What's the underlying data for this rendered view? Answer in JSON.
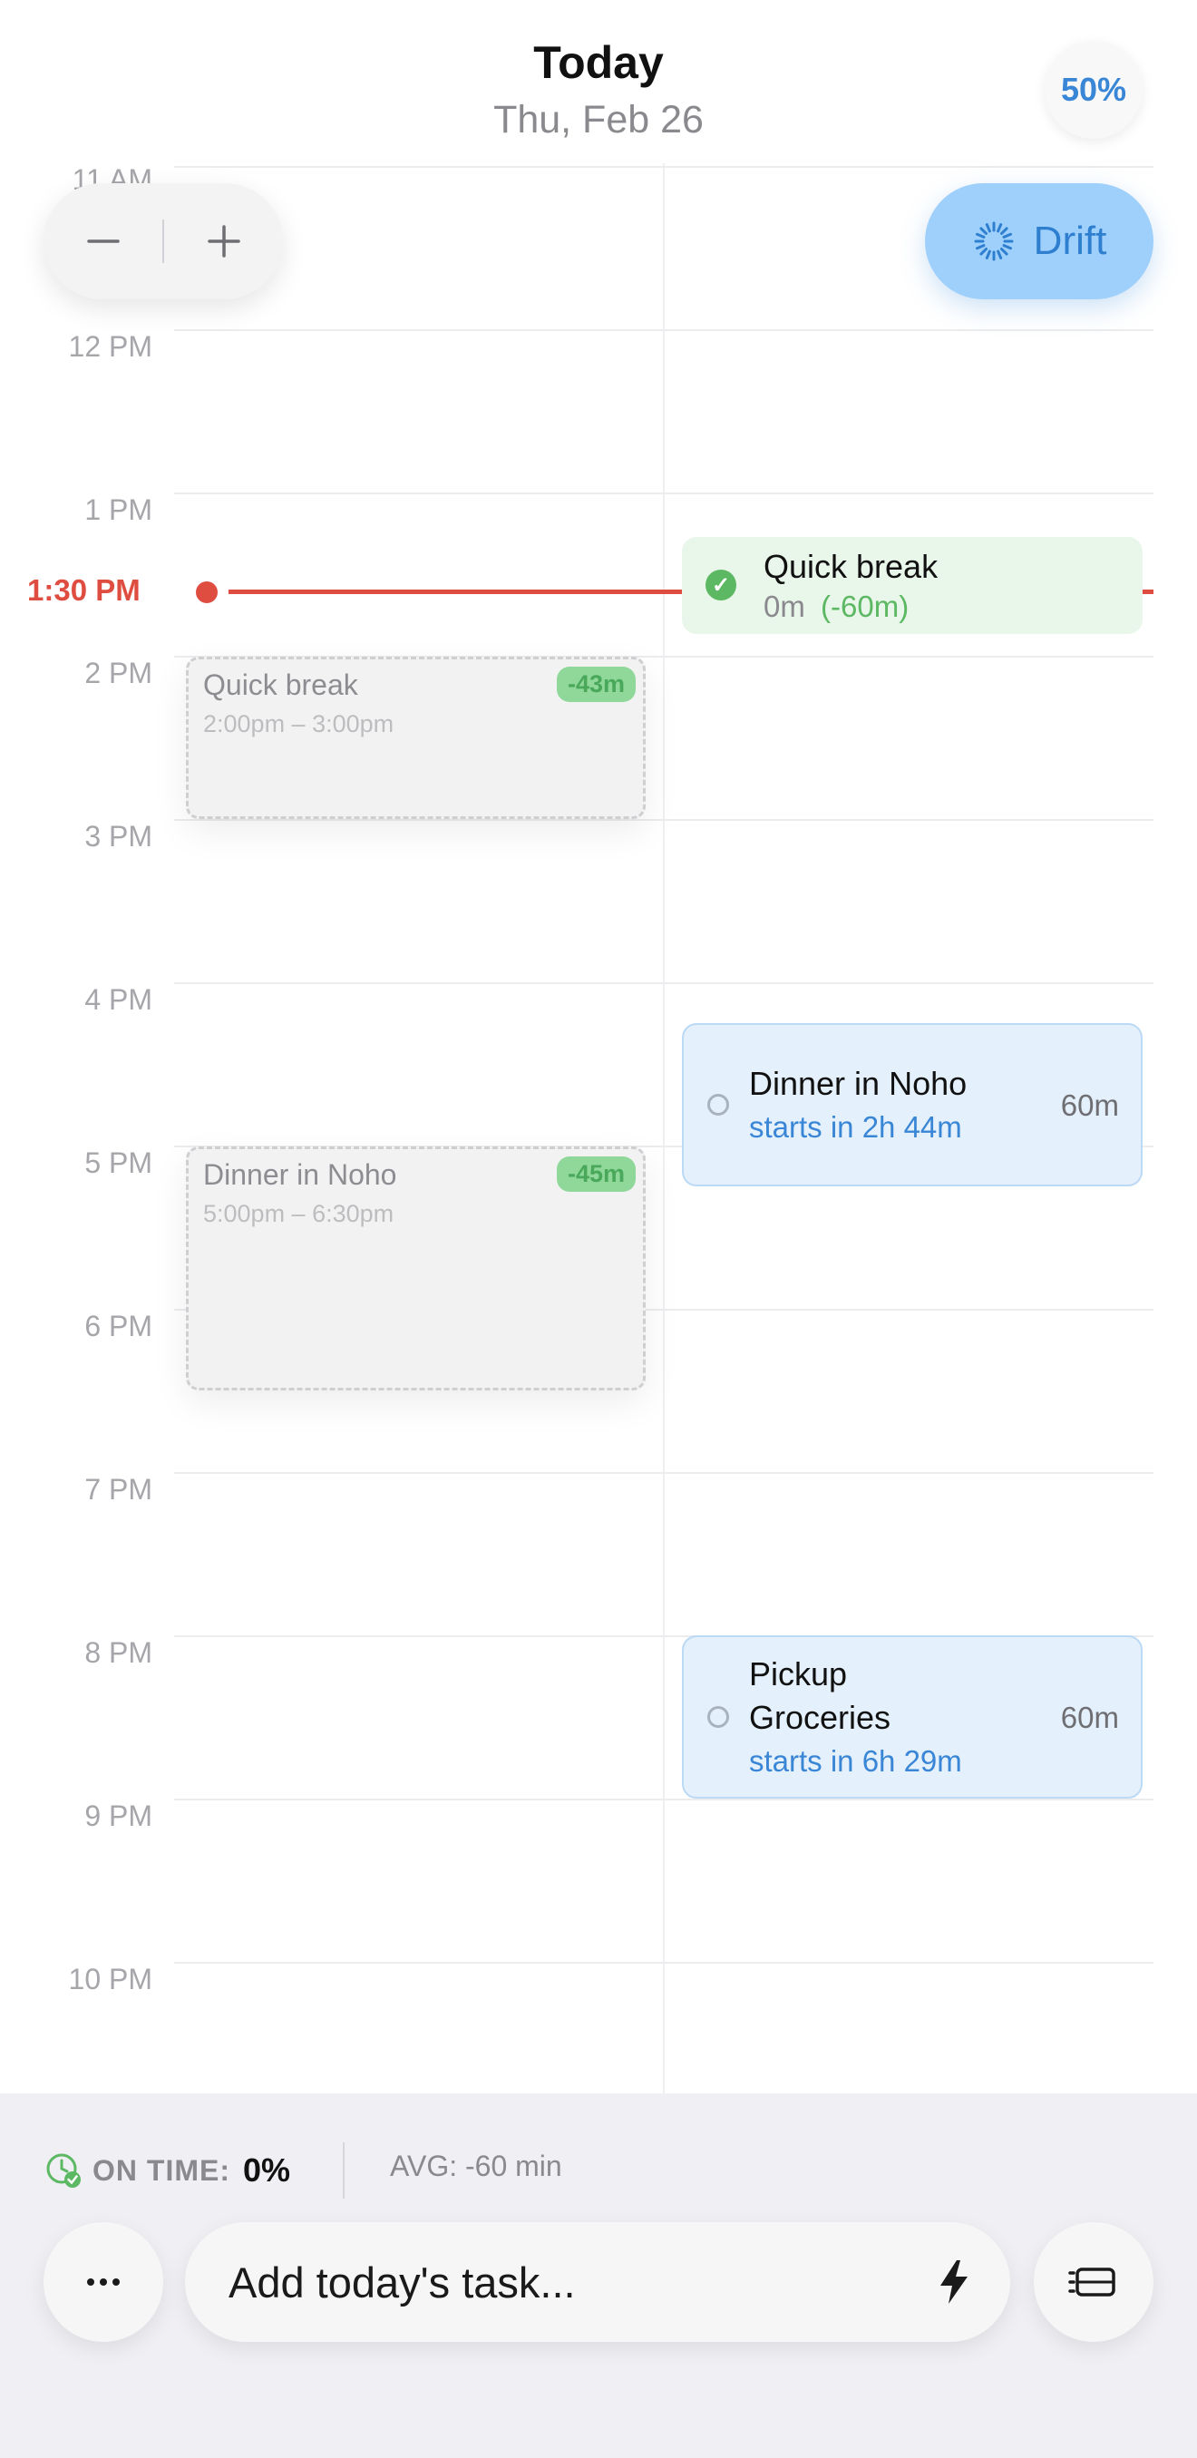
{
  "header": {
    "title": "Today",
    "date": "Thu, Feb 26",
    "percent": "50%"
  },
  "zoom": {
    "minus_icon": "minus-icon",
    "plus_icon": "plus-icon"
  },
  "drift": {
    "label": "Drift",
    "icon": "spinner-icon"
  },
  "timeline": {
    "hours": [
      "11 AM",
      "12 PM",
      "1 PM",
      "2 PM",
      "3 PM",
      "4 PM",
      "5 PM",
      "6 PM",
      "7 PM",
      "8 PM",
      "9 PM",
      "10 PM"
    ],
    "now_label": "1:30 PM"
  },
  "planned": [
    {
      "title": "Quick break",
      "time": "2:00pm – 3:00pm",
      "badge": "-43m"
    },
    {
      "title": "Dinner in Noho",
      "time": "5:00pm – 6:30pm",
      "badge": "-45m"
    }
  ],
  "tasks": [
    {
      "title": "Quick break",
      "duration": "0m",
      "delta": "(-60m)",
      "status": "done"
    },
    {
      "title": "Dinner in Noho",
      "status_text": "starts in 2h 44m",
      "duration": "60m"
    },
    {
      "title_line1": "Pickup",
      "title_line2": "Groceries",
      "status_text": "starts in 6h 29m",
      "duration": "60m"
    }
  ],
  "stats": {
    "on_time_label": "ON TIME:",
    "on_time_value": "0%",
    "avg": "AVG: -60 min"
  },
  "composer": {
    "more_icon": "ellipsis-icon",
    "placeholder": "Add today's task...",
    "bolt_icon": "bolt-icon",
    "list_icon": "list-icon"
  },
  "colors": {
    "accent": "#3a86d6",
    "now": "#df4d40",
    "done": "#5cb862"
  }
}
